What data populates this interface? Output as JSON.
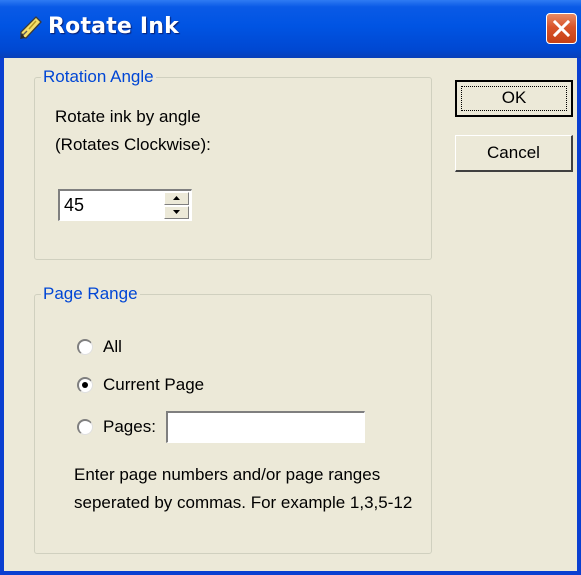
{
  "window": {
    "title": "Rotate Ink",
    "title_icon": "ink-pen-icon",
    "close_icon": "close-icon"
  },
  "rotation": {
    "group_title": "Rotation Angle",
    "description_line1": "Rotate ink by angle",
    "description_line2": "(Rotates Clockwise):",
    "angle_value": "45"
  },
  "buttons": {
    "ok_label": "OK",
    "cancel_label": "Cancel"
  },
  "page_range": {
    "group_title": "Page Range",
    "options": [
      "All",
      "Current Page",
      "Pages:"
    ],
    "selected": "Current Page",
    "pages_value": "",
    "hint_line1": "Enter page numbers and/or page ranges",
    "hint_line2": "seperated by commas. For example 1,3,5-12"
  },
  "colors": {
    "titlebar": "#0054e3",
    "dialog_bg": "#ece9d8",
    "group_title": "#0046d5",
    "close_button": "#d9542a"
  }
}
